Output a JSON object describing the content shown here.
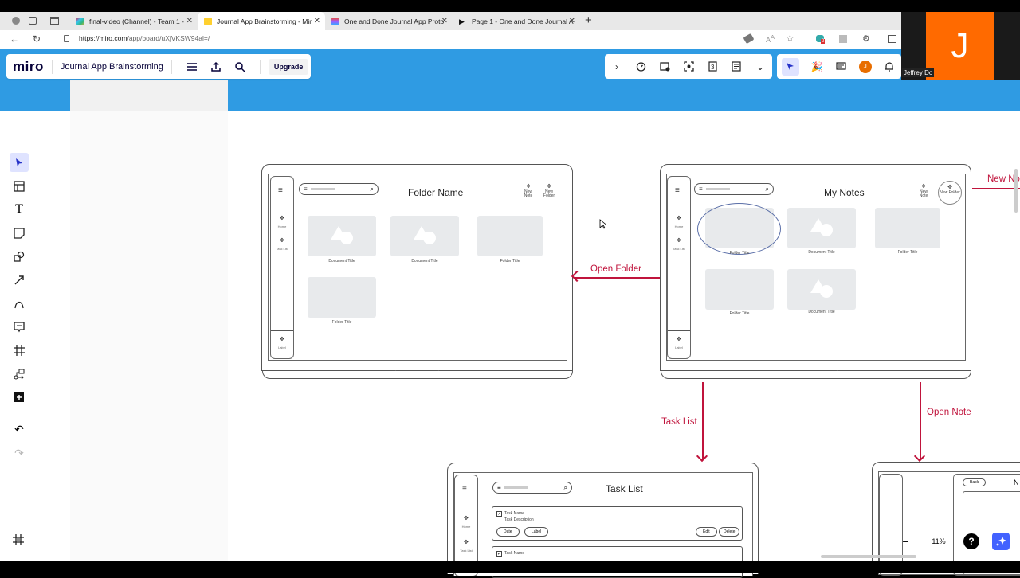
{
  "browser": {
    "tabs": [
      {
        "title": "final-video (Channel) - Team 1 -",
        "active": false
      },
      {
        "title": "Journal App Brainstorming - Mir",
        "active": true
      },
      {
        "title": "One and Done Journal App Proto",
        "active": false
      },
      {
        "title": "Page 1 - One and Done Journal A",
        "active": false
      }
    ],
    "url_host": "https://miro.com",
    "url_path": "/app/board/uXjVKSW94al=/",
    "extension_badge": "2"
  },
  "miro": {
    "logo": "miro",
    "board_title": "Journal App Brainstorming",
    "upgrade_label": "Upgrade",
    "avatar_initial": "J",
    "zoom_level": "11%",
    "help_label": "?"
  },
  "video": {
    "initial": "J",
    "name": "Jeffrey Do"
  },
  "toolbar": {
    "tools": [
      "select",
      "templates",
      "text",
      "sticky-note",
      "shapes",
      "connection-line",
      "pen",
      "comment",
      "frame",
      "mind-map",
      "more-apps"
    ],
    "undo": "undo",
    "redo": "redo"
  },
  "wireframes": {
    "folder": {
      "title": "Folder Name",
      "nav": [
        "Home",
        "Task List"
      ],
      "nav_bottom": "Label",
      "actions": [
        "New Note",
        "New Folder"
      ],
      "cards": [
        "Document Title",
        "Document Title",
        "Folder Title",
        "Folder Title"
      ]
    },
    "notes": {
      "title": "My Notes",
      "nav": [
        "Home",
        "Task List"
      ],
      "nav_bottom": "Label",
      "actions": [
        "New Note",
        "New Folder"
      ],
      "cards": [
        "Folder Title",
        "Document Title",
        "Folder Title",
        "Folder Title",
        "Document Title"
      ]
    },
    "tasks": {
      "title": "Task List",
      "nav": [
        "Home",
        "Task List"
      ],
      "task_name": "Task Name",
      "task_desc": "Task Description",
      "buttons": [
        "Date",
        "Label",
        "Edit",
        "Delete"
      ]
    },
    "note": {
      "back_label": "Back",
      "title_partial": "N"
    }
  },
  "connectors": {
    "open_folder": "Open Folder",
    "task_list": "Task List",
    "open_note": "Open Note",
    "new_note": "New No"
  },
  "colors": {
    "accent": "#2f9be3",
    "connector": "#c0143c",
    "video_bg": "#ff6a00",
    "ai_button": "#4262ff"
  }
}
